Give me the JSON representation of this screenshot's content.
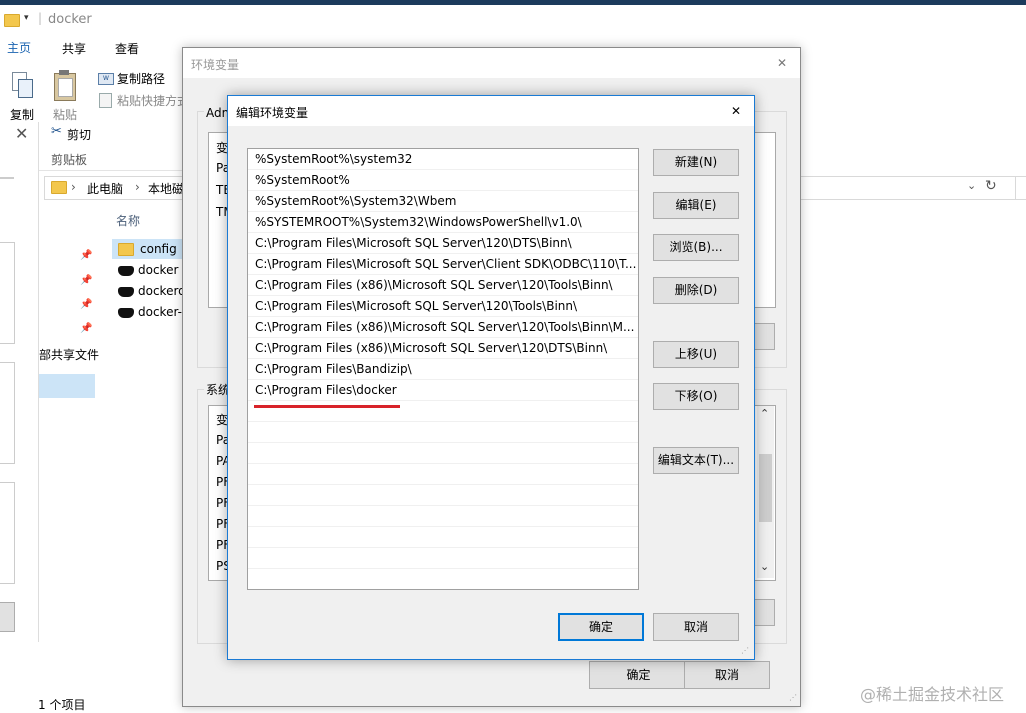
{
  "explorer": {
    "title": "docker",
    "tabs": [
      "主页",
      "共享",
      "查看"
    ],
    "ribbon": {
      "copy": "复制",
      "paste": "粘贴",
      "copy_path": "复制路径",
      "paste_shortcut": "粘贴快捷方式",
      "cut": "剪切",
      "clipboard": "剪贴板"
    },
    "breadcrumb": [
      "此电脑",
      "本地磁"
    ],
    "column_name": "名称",
    "files": [
      {
        "name": "config",
        "icon": "folder-icon"
      },
      {
        "name": "docker",
        "icon": "docker-icon"
      },
      {
        "name": "dockerd",
        "icon": "docker-icon"
      },
      {
        "name": "docker-",
        "icon": "docker-icon"
      }
    ],
    "nav_text": "部共享文件",
    "status": "1 个项目"
  },
  "env_dialog": {
    "title": "环境变量",
    "user_group_label": "Adm",
    "user_vars": [
      "变",
      "Pa",
      "TE",
      "TM"
    ],
    "system_group_label": "系统",
    "system_vars": [
      "变",
      "Pa",
      "PA",
      "PF",
      "PF",
      "PF",
      "PF",
      "PS"
    ],
    "ok": "确定",
    "cancel": "取消"
  },
  "edit_dialog": {
    "title": "编辑环境变量",
    "paths": [
      "%SystemRoot%\\system32",
      "%SystemRoot%",
      "%SystemRoot%\\System32\\Wbem",
      "%SYSTEMROOT%\\System32\\WindowsPowerShell\\v1.0\\",
      "C:\\Program Files\\Microsoft SQL Server\\120\\DTS\\Binn\\",
      "C:\\Program Files\\Microsoft SQL Server\\Client SDK\\ODBC\\110\\T...",
      "C:\\Program Files (x86)\\Microsoft SQL Server\\120\\Tools\\Binn\\",
      "C:\\Program Files\\Microsoft SQL Server\\120\\Tools\\Binn\\",
      "C:\\Program Files (x86)\\Microsoft SQL Server\\120\\Tools\\Binn\\M...",
      "C:\\Program Files (x86)\\Microsoft SQL Server\\120\\DTS\\Binn\\",
      "C:\\Program Files\\Bandizip\\",
      "C:\\Program Files\\docker"
    ],
    "buttons": {
      "new": "新建(N)",
      "edit": "编辑(E)",
      "browse": "浏览(B)...",
      "delete": "删除(D)",
      "move_up": "上移(U)",
      "move_down": "下移(O)",
      "edit_text": "编辑文本(T)..."
    },
    "ok": "确定",
    "cancel": "取消"
  },
  "watermark": "@稀土掘金技术社区",
  "colors": {
    "accent": "#0078d7",
    "highlight_underline": "#d8232a"
  }
}
